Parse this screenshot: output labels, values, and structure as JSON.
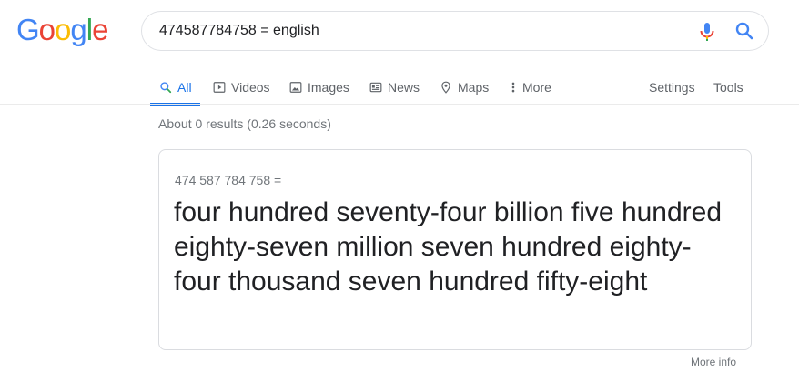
{
  "logo": {
    "letters": [
      "G",
      "o",
      "o",
      "g",
      "l",
      "e"
    ],
    "colors": [
      "#4285f4",
      "#ea4335",
      "#fbbc05",
      "#4285f4",
      "#34a853",
      "#ea4335"
    ]
  },
  "search": {
    "query": "474587784758 = english"
  },
  "tabs": [
    {
      "label": "All",
      "icon": "search-icon",
      "active": true
    },
    {
      "label": "Videos",
      "icon": "play-icon"
    },
    {
      "label": "Images",
      "icon": "image-icon"
    },
    {
      "label": "News",
      "icon": "news-icon"
    },
    {
      "label": "Maps",
      "icon": "map-pin-icon"
    },
    {
      "label": "More",
      "icon": "more-vert-icon"
    }
  ],
  "tools": {
    "settings": "Settings",
    "tools": "Tools"
  },
  "results": {
    "count_text": "About 0 results (0.26 seconds)"
  },
  "card": {
    "query": "474 587 784 758 =",
    "answer": "four hundred seventy-four billion five hundred eighty-seven million seven hundred eighty-four thousand seven hundred fifty-eight"
  },
  "footer": {
    "more_info": "More info"
  },
  "colors": {
    "accent": "#1a73e8",
    "muted": "#70757a",
    "border": "#dadce0"
  }
}
